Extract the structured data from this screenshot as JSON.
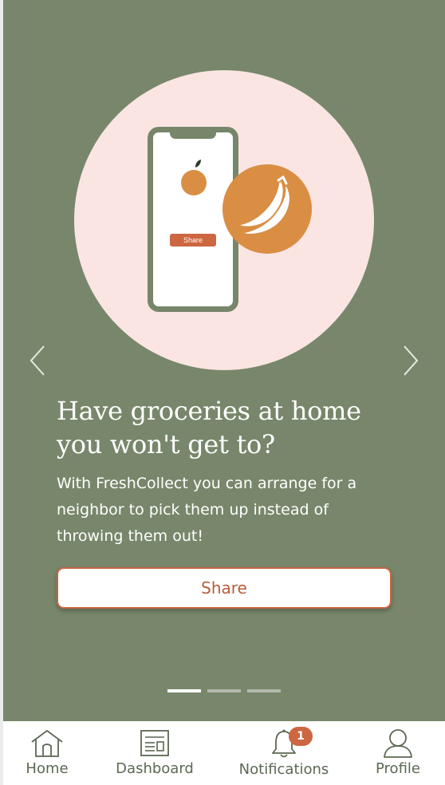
{
  "slide": {
    "title_line1": "Have groceries at home",
    "title_line2": "you won't get to?",
    "body": "With FreshCollect you can arrange for a neighbor to pick them up instead of throwing them out!",
    "cta_label": "Share",
    "illustration_button_label": "Share"
  },
  "carousel": {
    "slide_count": 3,
    "active_index": 0
  },
  "tabbar": {
    "items": [
      {
        "label": "Home",
        "icon": "home-icon"
      },
      {
        "label": "Dashboard",
        "icon": "dashboard-icon"
      },
      {
        "label": "Notifications",
        "icon": "bell-icon",
        "badge": "1"
      },
      {
        "label": "Profile",
        "icon": "profile-icon"
      }
    ]
  },
  "colors": {
    "background": "#78876b",
    "accent": "#cc6741",
    "circle": "#fae5e3",
    "banana_circle": "#d98e44"
  }
}
